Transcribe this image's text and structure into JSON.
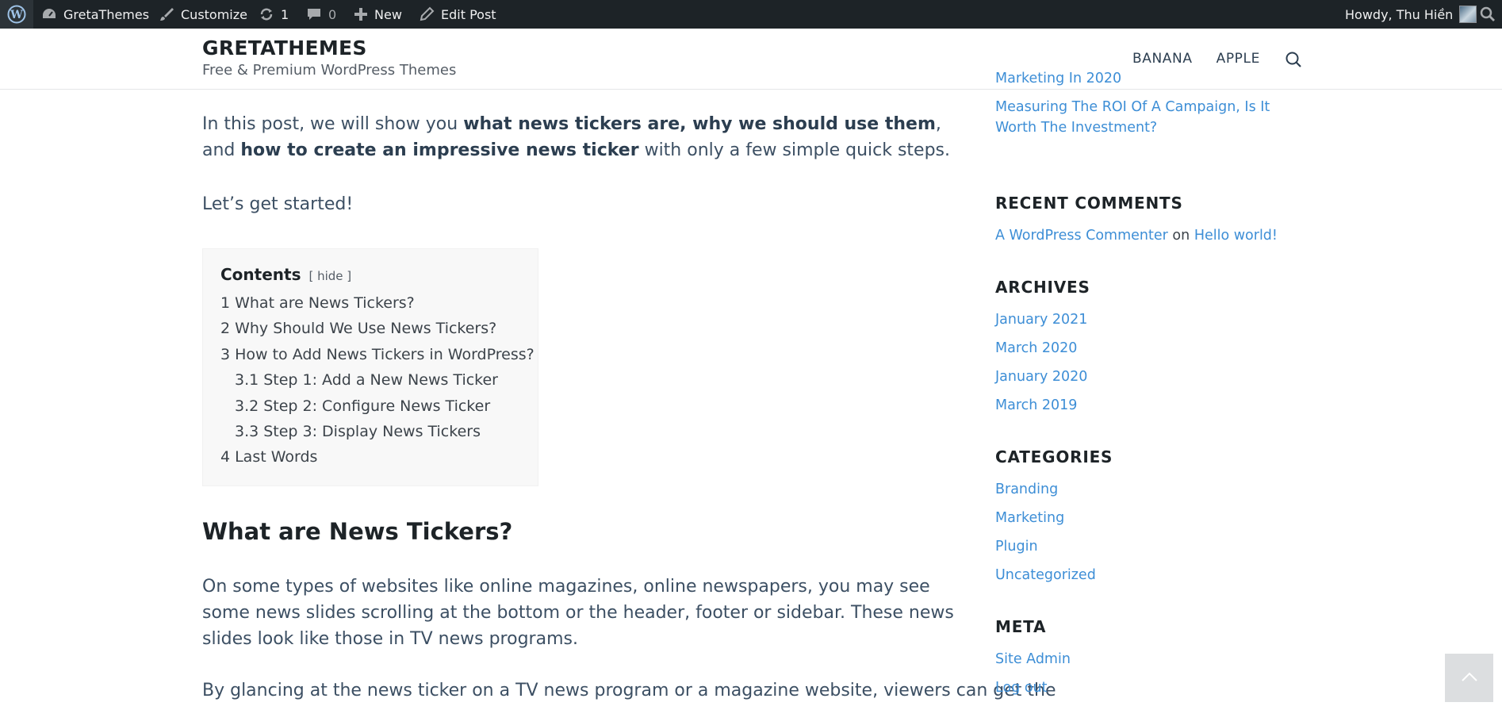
{
  "adminbar": {
    "site_name": "GretaThemes",
    "customize": "Customize",
    "updates_count": "1",
    "comments_count": "0",
    "new_label": "New",
    "edit_post": "Edit Post",
    "howdy": "Howdy, Thu Hiền"
  },
  "header": {
    "title": "GRETATHEMES",
    "description": "Free & Premium WordPress Themes",
    "nav": [
      "BANANA",
      "APPLE"
    ]
  },
  "content": {
    "intro_a": "In this post, we will show you ",
    "intro_b": "what news tickers are, why we should use them",
    "intro_c": ", and ",
    "intro_d": "how to create an impressive news ticker",
    "intro_e": " with only a few simple quick steps.",
    "started": "Let’s get started!",
    "toc": {
      "title": "Contents",
      "hide": "[ hide ]",
      "items": [
        {
          "num": "1",
          "text": "What are News Tickers?"
        },
        {
          "num": "2",
          "text": "Why Should We Use News Tickers?"
        },
        {
          "num": "3",
          "text": "How to Add News Tickers in WordPress?"
        },
        {
          "num": "3.1",
          "text": "Step 1: Add a New News Ticker"
        },
        {
          "num": "3.2",
          "text": "Step 2: Configure News Ticker"
        },
        {
          "num": "3.3",
          "text": "Step 3: Display News Tickers"
        },
        {
          "num": "4",
          "text": "Last Words"
        }
      ]
    },
    "heading": "What are News Tickers?",
    "para1": "On some types of websites like online magazines, online newspapers, you may see some news slides scrolling at the bottom or the header, footer or sidebar. These news slides look like those in TV news programs.",
    "para2": "By glancing at the news ticker on a TV news program or a magazine website, viewers can get the"
  },
  "sidebar": {
    "recent_posts": [
      "Marketing In 2020",
      "Measuring The ROI Of A Campaign, Is It Worth The Investment?"
    ],
    "recent_comments_title": "RECENT COMMENTS",
    "comment_author": "A WordPress Commenter",
    "comment_on": "on",
    "comment_post": "Hello world!",
    "archives_title": "ARCHIVES",
    "archives": [
      "January 2021",
      "March 2020",
      "January 2020",
      "March 2019"
    ],
    "categories_title": "CATEGORIES",
    "categories": [
      "Branding",
      "Marketing",
      "Plugin",
      "Uncategorized"
    ],
    "meta_title": "META",
    "meta": [
      "Site Admin",
      "Log out"
    ]
  },
  "icons": {
    "wordpress": "wordpress-logo-icon",
    "dashboard": "dashboard-icon",
    "customize": "brush-icon",
    "updates": "refresh-icon",
    "comments": "comment-bubble-icon",
    "new": "plus-icon",
    "edit": "pencil-icon",
    "search": "search-icon",
    "back_to_top": "chevron-up-icon"
  },
  "colors": {
    "adminbar_bg": "#1d2327",
    "link": "#3d8ed6",
    "heading": "#1d2327"
  }
}
